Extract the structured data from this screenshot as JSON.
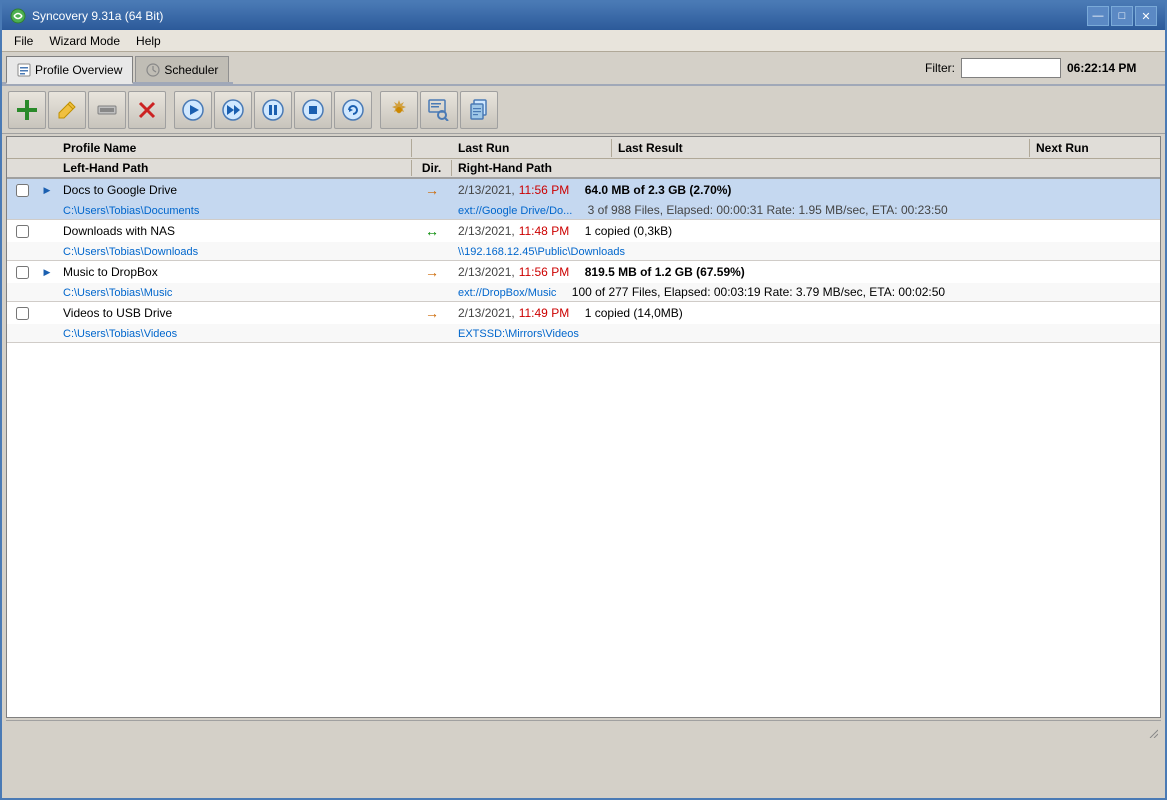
{
  "titlebar": {
    "title": "Syncovery 9.31a (64 Bit)",
    "icon": "sync-icon",
    "controls": {
      "minimize": "—",
      "maximize": "□",
      "close": "✕"
    }
  },
  "menubar": {
    "items": [
      {
        "label": "File"
      },
      {
        "label": "Wizard Mode"
      },
      {
        "label": "Help"
      }
    ]
  },
  "tabs": [
    {
      "id": "profile-overview",
      "label": "Profile Overview",
      "active": true
    },
    {
      "id": "scheduler",
      "label": "Scheduler",
      "active": false
    }
  ],
  "filter": {
    "label": "Filter:",
    "placeholder": "",
    "value": ""
  },
  "clock": "06:22:14 PM",
  "toolbar": {
    "buttons": [
      {
        "id": "add",
        "icon": "➕",
        "tooltip": "Add Profile",
        "color": "#2a8a2a"
      },
      {
        "id": "edit",
        "icon": "✏️",
        "tooltip": "Edit Profile"
      },
      {
        "id": "minus",
        "icon": "▬",
        "tooltip": "Remove Profile"
      },
      {
        "id": "delete",
        "icon": "✖",
        "tooltip": "Delete Profile",
        "color": "#cc2222"
      },
      {
        "id": "run",
        "icon": "▶",
        "tooltip": "Run Profile",
        "color": "#1a5fb0"
      },
      {
        "id": "run-next",
        "icon": "⏭",
        "tooltip": "Run Next",
        "color": "#1a5fb0"
      },
      {
        "id": "pause",
        "icon": "⏸",
        "tooltip": "Pause",
        "color": "#1a5fb0"
      },
      {
        "id": "stop",
        "icon": "⏹",
        "tooltip": "Stop",
        "color": "#1a5fb0"
      },
      {
        "id": "refresh",
        "icon": "🔄",
        "tooltip": "Refresh"
      },
      {
        "id": "settings",
        "icon": "⚙",
        "tooltip": "Settings",
        "color": "#cc8800"
      },
      {
        "id": "search",
        "icon": "🔍",
        "tooltip": "Search"
      },
      {
        "id": "copy",
        "icon": "📋",
        "tooltip": "Copy"
      }
    ]
  },
  "table": {
    "headers": {
      "row1": [
        {
          "id": "check",
          "label": ""
        },
        {
          "id": "play",
          "label": ""
        },
        {
          "id": "name",
          "label": "Profile Name"
        },
        {
          "id": "dir",
          "label": ""
        },
        {
          "id": "lastrun",
          "label": "Last Run"
        },
        {
          "id": "lastresult",
          "label": "Last Result"
        },
        {
          "id": "nextrun",
          "label": "Next Run"
        }
      ],
      "row2": [
        {
          "id": "check2",
          "label": ""
        },
        {
          "id": "play2",
          "label": ""
        },
        {
          "id": "lhpath",
          "label": "Left-Hand Path"
        },
        {
          "id": "dir2",
          "label": "Dir."
        },
        {
          "id": "rhpath",
          "label": "Right-Hand Path"
        }
      ]
    },
    "profiles": [
      {
        "id": "docs-to-google",
        "active": true,
        "checked": false,
        "playing": true,
        "name": "Docs to Google Drive",
        "leftPath": "C:\\Users\\Tobias\\Documents",
        "dir": "→",
        "dirColor": "orange",
        "rightPath": "ext://Google Drive/Do...",
        "lastRunDate": "2/13/2021,",
        "lastRunTime": "11:56 PM",
        "lastResultBold": "64.0 MB of 2.3 GB (2.70%)",
        "lastResultSub": "3 of 988 Files, Elapsed: 00:00:31  Rate: 1.95 MB/sec, ETA: 00:23:50",
        "nextRun": ""
      },
      {
        "id": "downloads-with-nas",
        "active": false,
        "checked": false,
        "playing": false,
        "name": "Downloads with NAS",
        "leftPath": "C:\\Users\\Tobias\\Downloads",
        "dir": "↔",
        "dirColor": "green",
        "rightPath": "\\\\192.168.12.45\\Public\\Downloads",
        "lastRunDate": "2/13/2021,",
        "lastRunTime": "11:48 PM",
        "lastResultBold": "",
        "lastResultSub": "1 copied (0,3kB)",
        "nextRun": ""
      },
      {
        "id": "music-to-dropbox",
        "active": false,
        "checked": false,
        "playing": true,
        "name": "Music to DropBox",
        "leftPath": "C:\\Users\\Tobias\\Music",
        "dir": "→",
        "dirColor": "orange",
        "rightPath": "ext://DropBox/Music",
        "lastRunDate": "2/13/2021,",
        "lastRunTime": "11:56 PM",
        "lastResultBold": "819.5 MB of 1.2 GB (67.59%)",
        "lastResultSub": "100 of 277 Files, Elapsed: 00:03:19  Rate: 3.79 MB/sec, ETA: 00:02:50",
        "nextRun": ""
      },
      {
        "id": "videos-to-usb",
        "active": false,
        "checked": false,
        "playing": false,
        "name": "Videos to USB Drive",
        "leftPath": "C:\\Users\\Tobias\\Videos",
        "dir": "→",
        "dirColor": "orange",
        "rightPath": "EXTSSD:\\Mirrors\\Videos",
        "lastRunDate": "2/13/2021,",
        "lastRunTime": "11:49 PM",
        "lastResultBold": "",
        "lastResultSub": "1 copied (14,0MB)",
        "nextRun": ""
      }
    ]
  }
}
